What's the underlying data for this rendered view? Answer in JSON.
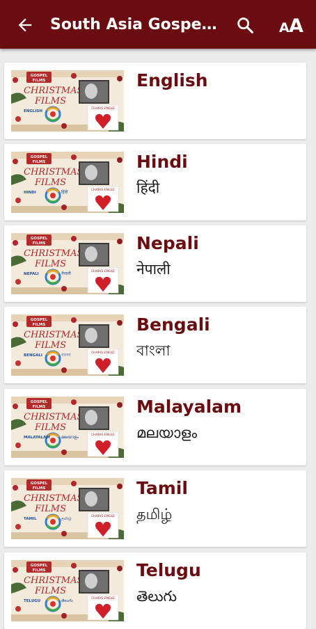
{
  "appbar": {
    "title": "South Asia Gospel...",
    "back_icon": "arrow-back-icon",
    "search_icon": "search-icon",
    "font_icon": "font-size-icon",
    "color": "#6b0d10"
  },
  "thumbnail": {
    "badge_line1": "GOSPEL",
    "badge_line2": "FILMS",
    "heading_line1": "CHRISTMAS",
    "heading_line2": "FILMS",
    "side_label": "CHARIS ENGLE"
  },
  "languages": [
    {
      "name": "English",
      "native": "",
      "thumb_label": "ENGLISH",
      "thumb_native": ""
    },
    {
      "name": "Hindi",
      "native": "हिंदी",
      "thumb_label": "HINDI",
      "thumb_native": "हिंदी"
    },
    {
      "name": "Nepali",
      "native": "नेपाली",
      "thumb_label": "NEPALI",
      "thumb_native": "नेपाली"
    },
    {
      "name": "Bengali",
      "native": "বাংলা",
      "thumb_label": "BENGALI",
      "thumb_native": "বাংলা"
    },
    {
      "name": "Malayalam",
      "native": "മലയാളം",
      "thumb_label": "MALAYALAM",
      "thumb_native": "മലയാളം"
    },
    {
      "name": "Tamil",
      "native": "தமிழ்",
      "thumb_label": "TAMIL",
      "thumb_native": "தமிழ்"
    },
    {
      "name": "Telugu",
      "native": "తెలుగు",
      "thumb_label": "TELUGU",
      "thumb_native": "తెలుగు"
    }
  ]
}
